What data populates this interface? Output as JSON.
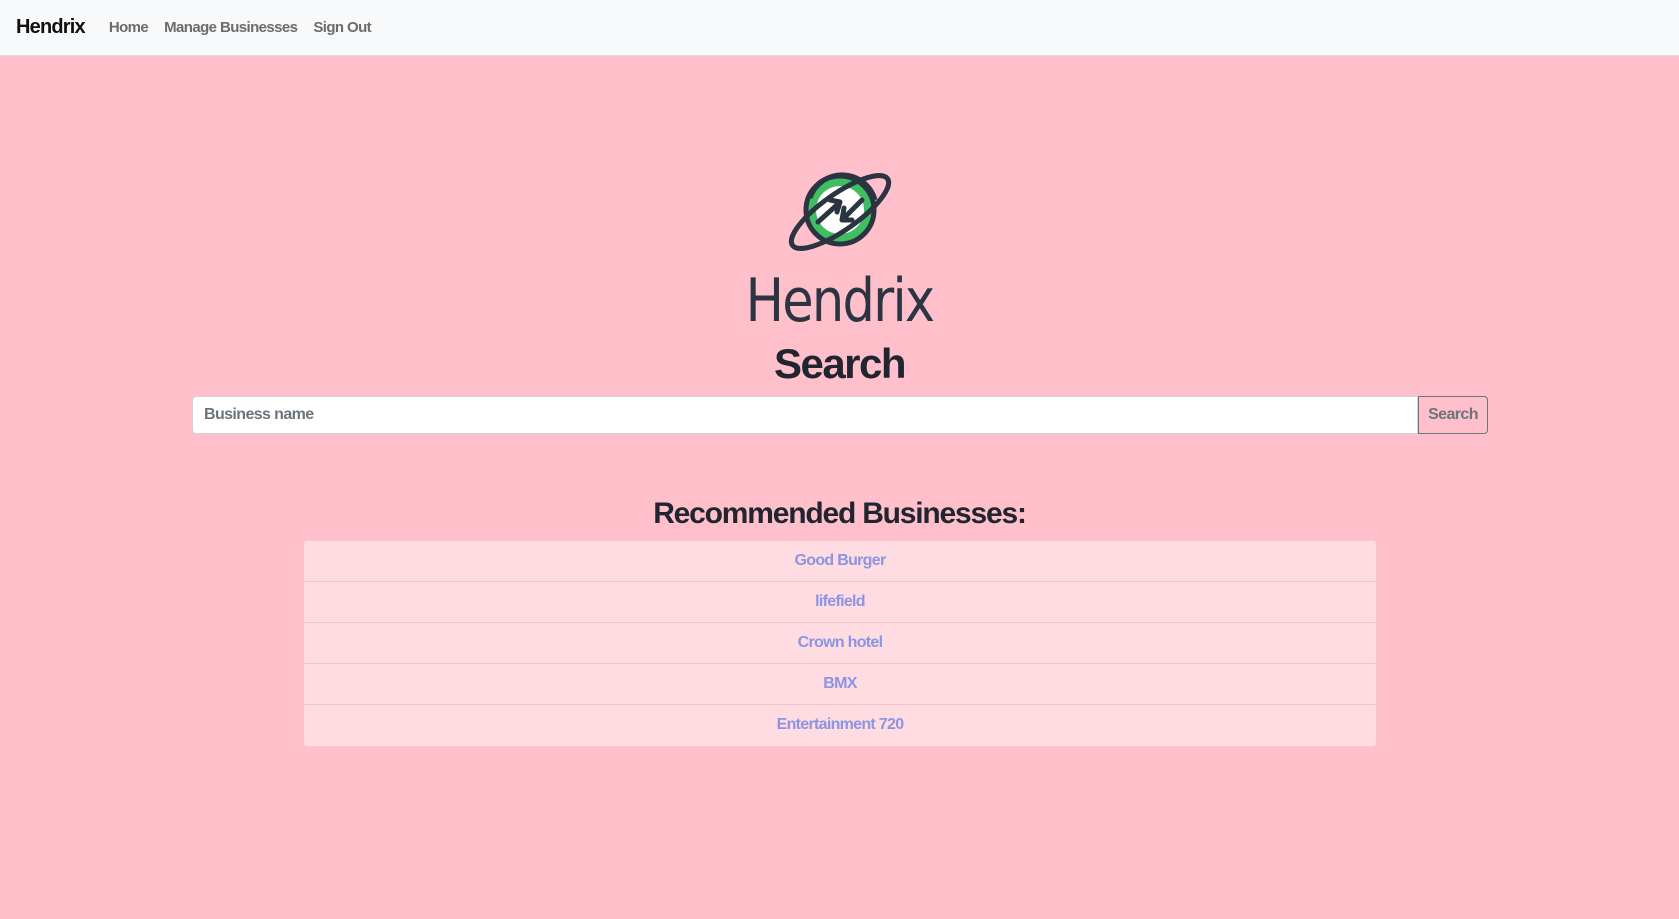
{
  "navbar": {
    "brand": "Hendrix",
    "links": [
      {
        "label": "Home"
      },
      {
        "label": "Manage Businesses"
      },
      {
        "label": "Sign Out"
      }
    ]
  },
  "hero": {
    "logo_icon": "planet-sync-icon",
    "logo_text": "Hendrix",
    "colors": {
      "logo_green": "#3fbe62",
      "logo_dark": "#2b3440"
    }
  },
  "search": {
    "heading": "Search",
    "placeholder": "Business name",
    "button_label": "Search"
  },
  "recommended": {
    "heading": "Recommended Businesses:",
    "items": [
      {
        "label": "Good Burger"
      },
      {
        "label": "lifefield"
      },
      {
        "label": "Crown hotel"
      },
      {
        "label": "BMX"
      },
      {
        "label": "Entertainment 720"
      }
    ]
  },
  "theme": {
    "background": "#ffc0cb",
    "navbar_bg": "#f8f9fa",
    "link_color": "#8b95e3"
  }
}
